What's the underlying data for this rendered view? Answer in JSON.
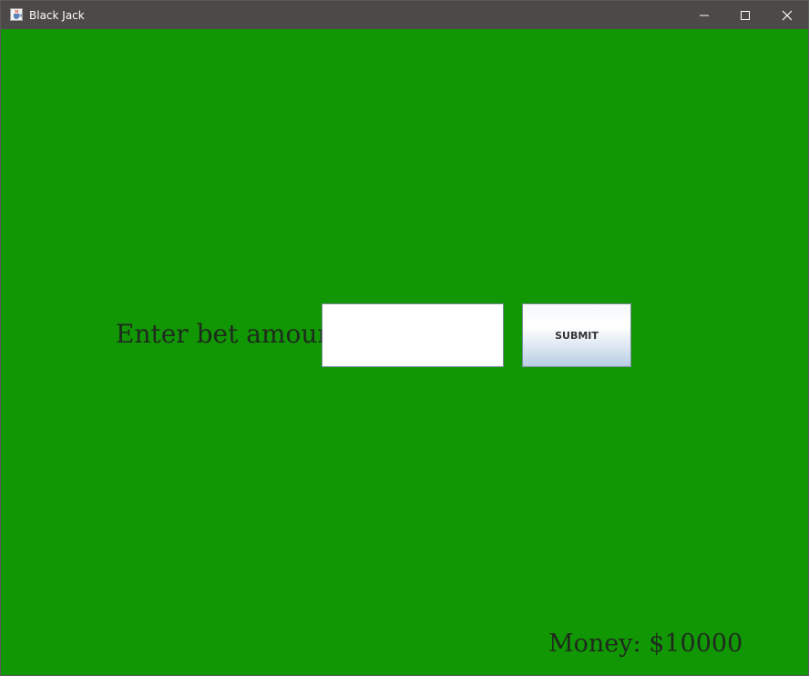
{
  "window": {
    "title": "Black Jack",
    "icon": "java-cup-icon",
    "controls": [
      "minimize-icon",
      "maximize-icon",
      "close-icon"
    ]
  },
  "bet": {
    "label": "Enter bet amount:",
    "input_value": "",
    "submit_label": "SUBMIT"
  },
  "status": {
    "money": "Money: $10000"
  },
  "colors": {
    "table_green": "#119703",
    "titlebar": "#4c4a48"
  }
}
